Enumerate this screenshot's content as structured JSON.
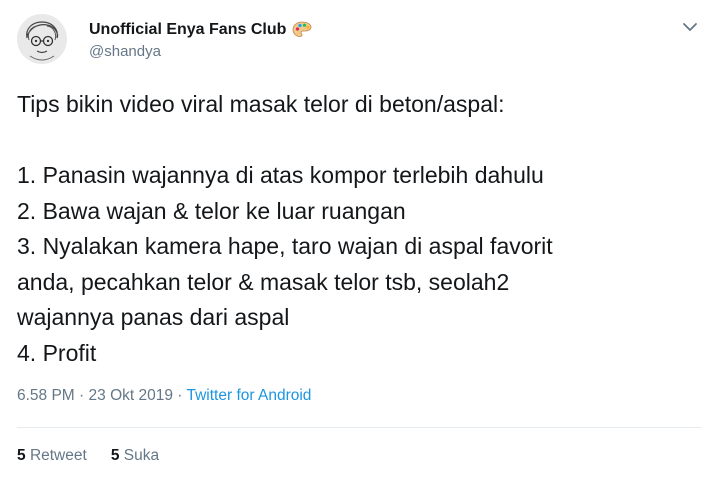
{
  "author": {
    "display_name": "Unofficial Enya Fans Club",
    "handle": "@shandya",
    "avatar_icon": "cartoon-avatar",
    "badge_icon": "artist-palette-icon"
  },
  "tweet": {
    "text": "Tips bikin video viral masak telor di beton/aspal:\n\n1. Panasin wajannya di atas kompor terlebih dahulu\n2. Bawa wajan & telor ke luar ruangan\n3. Nyalakan kamera hape, taro wajan di aspal favorit\nanda, pecahkan telor & masak telor tsb, seolah2\nwajannya panas dari aspal\n4. Profit",
    "time": "6.58 PM",
    "date": "23 Okt 2019",
    "separator": "·",
    "source": "Twitter for Android"
  },
  "stats": {
    "retweet_count": "5",
    "retweet_label": "Retweet",
    "like_count": "5",
    "like_label": "Suka"
  },
  "colors": {
    "link": "#1b95e0",
    "muted": "#657786",
    "text": "#14171a"
  }
}
